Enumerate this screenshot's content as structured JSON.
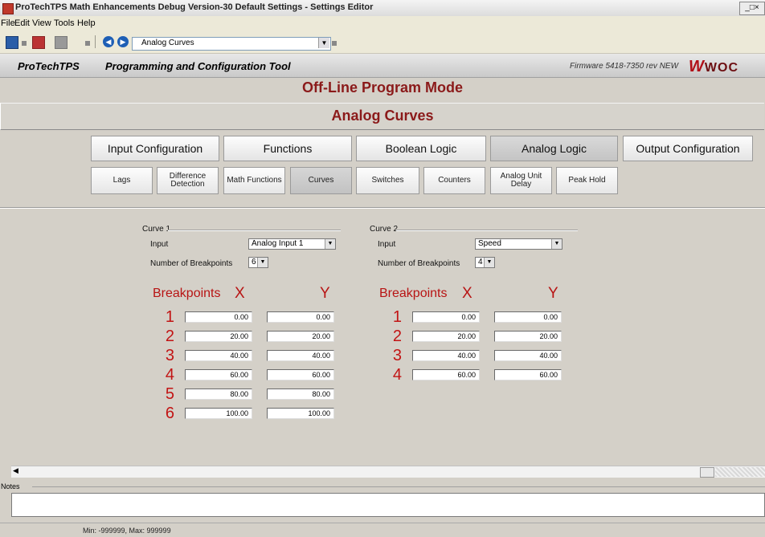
{
  "window": {
    "title": "ProTechTPS Math Enhancements Debug Version-30 Default Settings - Settings Editor",
    "controls": "_□×"
  },
  "menu": [
    "File",
    "Edit",
    "View",
    "Tools",
    "Help"
  ],
  "toolbar": {
    "combo_value": "Analog Curves",
    "back_glyph": "◀",
    "forward_glyph": "▶",
    "dropdown_glyph": "▼"
  },
  "header": {
    "app_name": "ProTechTPS",
    "subtitle": "Programming and Configuration Tool",
    "firmware": "Firmware 5418-7350 rev NEW",
    "logo_w": "W",
    "logo_text": "WOC"
  },
  "mode_title": "Off-Line Program Mode",
  "page_title": "Analog Curves",
  "nav": {
    "tabs": [
      {
        "label": "Input Configuration"
      },
      {
        "label": "Functions"
      },
      {
        "label": "Boolean Logic"
      },
      {
        "label": "Analog Logic"
      },
      {
        "label": "Output Configuration"
      }
    ],
    "subtabs": [
      {
        "label": "Lags"
      },
      {
        "label": "Difference Detection"
      },
      {
        "label": "Math Functions"
      },
      {
        "label": "Curves"
      },
      {
        "label": "Switches"
      },
      {
        "label": "Counters"
      },
      {
        "label": "Analog Unit Delay"
      },
      {
        "label": "Peak Hold"
      }
    ]
  },
  "curve1": {
    "title": "Curve 1",
    "input_label": "Input",
    "input_value": "Analog Input 1",
    "bp_label": "Number of Breakpoints",
    "bp_value": "6",
    "hdr_bp": "Breakpoints",
    "hdr_x": "X",
    "hdr_y": "Y",
    "rows": [
      {
        "i": "1",
        "x": "0.00",
        "y": "0.00"
      },
      {
        "i": "2",
        "x": "20.00",
        "y": "20.00"
      },
      {
        "i": "3",
        "x": "40.00",
        "y": "40.00"
      },
      {
        "i": "4",
        "x": "60.00",
        "y": "60.00"
      },
      {
        "i": "5",
        "x": "80.00",
        "y": "80.00"
      },
      {
        "i": "6",
        "x": "100.00",
        "y": "100.00"
      }
    ]
  },
  "curve2": {
    "title": "Curve 2",
    "input_label": "Input",
    "input_value": "Speed",
    "bp_label": "Number of Breakpoints",
    "bp_value": "4",
    "hdr_bp": "Breakpoints",
    "hdr_x": "X",
    "hdr_y": "Y",
    "rows": [
      {
        "i": "1",
        "x": "0.00",
        "y": "0.00"
      },
      {
        "i": "2",
        "x": "20.00",
        "y": "20.00"
      },
      {
        "i": "3",
        "x": "40.00",
        "y": "40.00"
      },
      {
        "i": "4",
        "x": "60.00",
        "y": "60.00"
      }
    ]
  },
  "notes_label": "Notes",
  "status": "Min: -999999, Max: 999999"
}
